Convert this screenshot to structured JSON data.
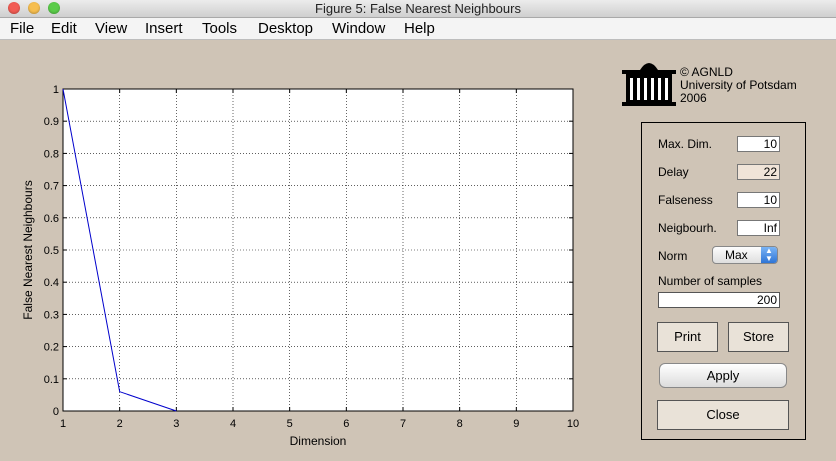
{
  "window": {
    "title": "Figure 5: False Nearest Neighbours"
  },
  "menu": [
    "File",
    "Edit",
    "View",
    "Insert",
    "Tools",
    "Desktop",
    "Window",
    "Help"
  ],
  "logo": {
    "lines": [
      "© AGNLD",
      "University of Potsdam",
      "2006"
    ],
    "icon": "university-building-icon"
  },
  "panel": {
    "max_dim": {
      "label": "Max. Dim.",
      "value": "10"
    },
    "delay": {
      "label": "Delay",
      "value": "22"
    },
    "falseness": {
      "label": "Falseness",
      "value": "10"
    },
    "neighbourhood": {
      "label": "Neigbourh.",
      "value": "Inf"
    },
    "norm": {
      "label": "Norm",
      "value": "Max"
    },
    "samples": {
      "label": "Number of samples",
      "value": "200"
    },
    "buttons": {
      "print": "Print",
      "store": "Store",
      "apply": "Apply",
      "close": "Close"
    }
  },
  "chart_data": {
    "type": "line",
    "xlabel": "Dimension",
    "ylabel": "False Nearest Neighbours",
    "xlim": [
      1,
      10
    ],
    "ylim": [
      0,
      1
    ],
    "xticks": [
      "1",
      "2",
      "3",
      "4",
      "5",
      "6",
      "7",
      "8",
      "9",
      "10"
    ],
    "yticks": [
      "0",
      "0.1",
      "0.2",
      "0.3",
      "0.4",
      "0.5",
      "0.6",
      "0.7",
      "0.8",
      "0.9",
      "1"
    ],
    "grid": true,
    "series": [
      {
        "x": [
          1,
          2,
          3
        ],
        "y": [
          1.0,
          0.06,
          0.0
        ],
        "color": "#0000cc"
      }
    ]
  },
  "colors": {
    "background": "#cfc4b6",
    "line": "#0000cc",
    "delay_field": "#f0e4d8"
  }
}
